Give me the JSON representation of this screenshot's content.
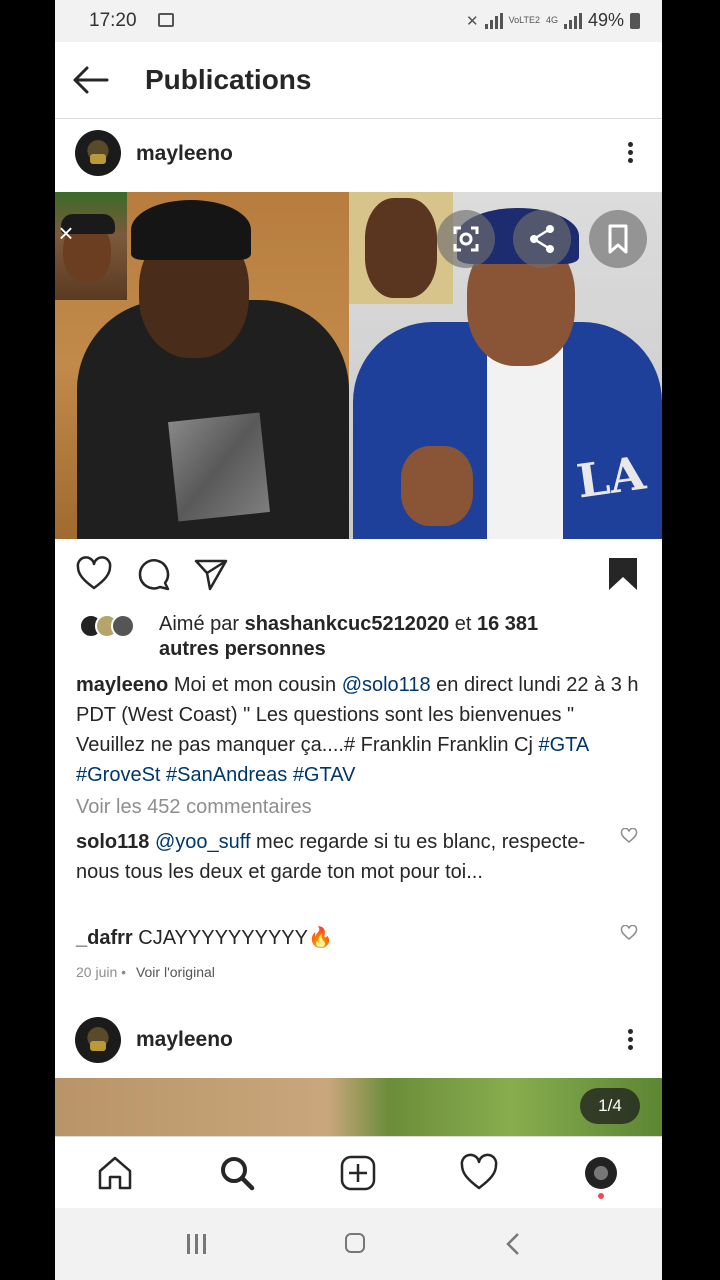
{
  "status_bar": {
    "time": "17:20",
    "network_label": "VoLTE2",
    "network_4g": "4G",
    "battery": "49%"
  },
  "header": {
    "title": "Publications"
  },
  "post": {
    "username": "mayleeno",
    "likes": {
      "prefix": "Aimé par ",
      "user": "shashankcuc5212020",
      "middle": " et ",
      "count": "16 381",
      "line2": "autres personnes"
    },
    "caption": {
      "user": "mayleeno",
      "t1": " Moi et mon cousin ",
      "mention": "@solo118",
      "t2": " en direct lundi 22 à 3 h PDT (West Coast) \" Les questions sont les bienvenues \" Veuillez ne pas manquer ça....# Franklin Franklin Cj ",
      "tags": [
        "#GTA",
        "#GroveSt",
        "#SanAndreas",
        "#GTAV"
      ]
    },
    "view_comments": "Voir les 452 commentaires",
    "comments": [
      {
        "user": "solo118",
        "mention": "@yoo_suff",
        "text": " mec regarde si tu es blanc, respecte-nous tous les deux et garde ton mot pour toi..."
      },
      {
        "user": "_dafrr",
        "mention": "",
        "text": " CJAYYYYYYYYYY🔥"
      }
    ],
    "date": "20 juin",
    "see_original": "Voir l'original"
  },
  "post2": {
    "username": "mayleeno",
    "counter": "1/4"
  },
  "icons": {
    "back": "back-arrow-icon",
    "more": "more-icon",
    "heart": "heart-icon",
    "comment": "comment-icon",
    "share": "send-icon",
    "bookmark": "bookmark-icon",
    "home": "home-icon",
    "search": "search-icon",
    "add": "add-icon",
    "activity": "heart-icon"
  },
  "colors": {
    "link": "#00376b",
    "muted": "#8e8e8e",
    "text": "#262626",
    "accent_dot": "#ed4956"
  }
}
